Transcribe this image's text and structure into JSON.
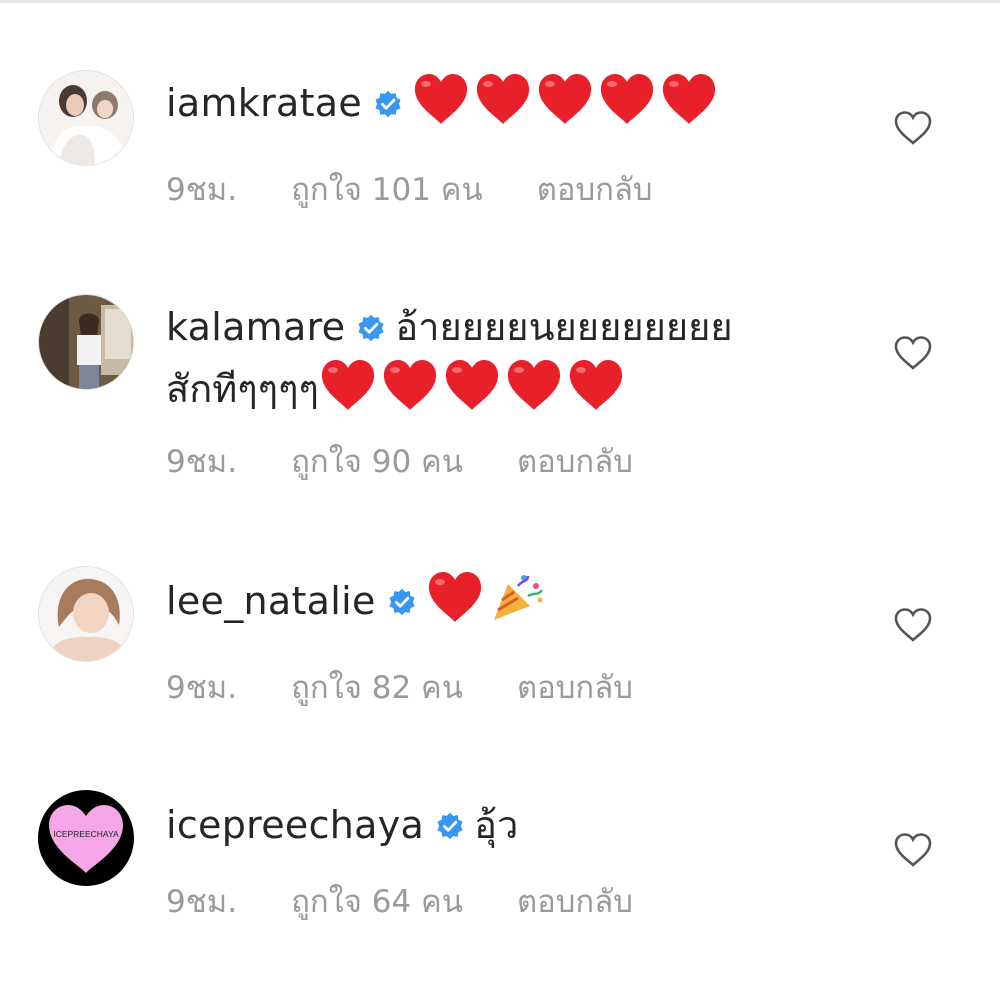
{
  "comments": [
    {
      "username": "iamkratae",
      "text": "",
      "hearts": 5,
      "time": "9ชม.",
      "likes": "ถูกใจ 101 คน",
      "reply": "ตอบกลับ"
    },
    {
      "username": "kalamare",
      "text": "อ้ายยยยนยยยยยยยย",
      "text2": "สักทีๆๆๆๆ",
      "hearts": 5,
      "time": "9ชม.",
      "likes": "ถูกใจ 90 คน",
      "reply": "ตอบกลับ"
    },
    {
      "username": "lee_natalie",
      "text": "",
      "hearts": 1,
      "emoji": "party-popper",
      "time": "9ชม.",
      "likes": "ถูกใจ 82 คน",
      "reply": "ตอบกลับ"
    },
    {
      "username": "icepreechaya",
      "text": "อุ้ว",
      "hearts": 0,
      "avatar_text": "ICEPREECHAYA",
      "time": "9ชม.",
      "likes": "ถูกใจ 64 คน",
      "reply": "ตอบกลับ"
    }
  ],
  "colors": {
    "verified": "#3897f0",
    "heart": "#e8202a",
    "meta": "#9a9a9a",
    "icepreechaya_avatar_bg": "#000000",
    "icepreechaya_avatar_heart": "#f4a6e6"
  },
  "icons": [
    "verified-badge-icon",
    "red-heart-emoji",
    "party-popper-emoji",
    "like-heart-outline-icon"
  ]
}
